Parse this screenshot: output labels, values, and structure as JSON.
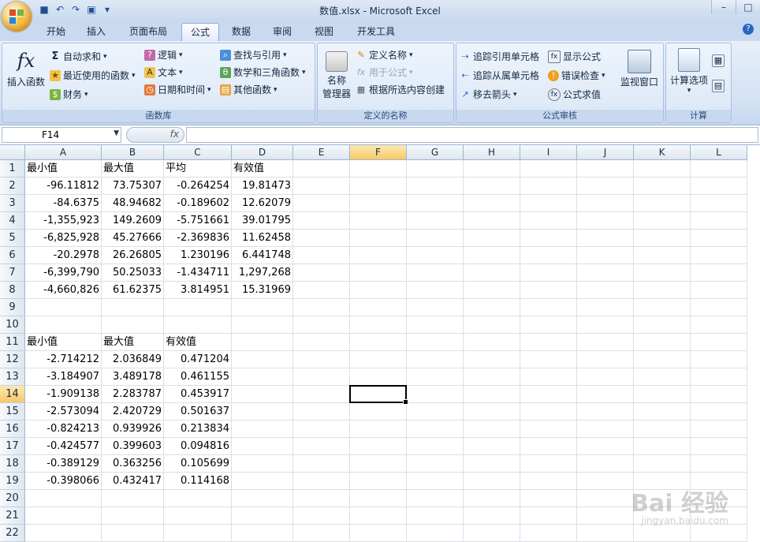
{
  "window": {
    "title": "数值.xlsx - Microsoft Excel",
    "minimize": "–",
    "restore": "□"
  },
  "tabs": [
    "开始",
    "插入",
    "页面布局",
    "公式",
    "数据",
    "审阅",
    "视图",
    "开发工具"
  ],
  "active_tab": "公式",
  "ribbon": {
    "function_library": {
      "label": "函数库",
      "insert_function": "插入函数",
      "autosum": "自动求和",
      "recent": "最近使用的函数",
      "financial": "财务",
      "logical": "逻辑",
      "text": "文本",
      "datetime": "日期和时间",
      "lookup": "查找与引用",
      "math": "数学和三角函数",
      "more": "其他函数"
    },
    "defined_names": {
      "label": "定义的名称",
      "name_manager_line1": "名称",
      "name_manager_line2": "管理器",
      "define_name": "定义名称",
      "use_in_formula": "用于公式",
      "create_from_selection": "根据所选内容创建"
    },
    "formula_auditing": {
      "label": "公式审核",
      "trace_precedents": "追踪引用单元格",
      "trace_dependents": "追踪从属单元格",
      "remove_arrows": "移去箭头",
      "show_formulas": "显示公式",
      "error_checking": "错误检查",
      "evaluate_formula": "公式求值",
      "watch_window": "监视窗口"
    },
    "calculation": {
      "label": "计算",
      "options": "计算选项"
    }
  },
  "formula_bar": {
    "name_box": "F14",
    "fx": "fx",
    "formula": ""
  },
  "sheet": {
    "columns": [
      "A",
      "B",
      "C",
      "D",
      "E",
      "F",
      "G",
      "H",
      "I",
      "J",
      "K",
      "L"
    ],
    "selected_column": "F",
    "rows": [
      "1",
      "2",
      "3",
      "4",
      "5",
      "6",
      "7",
      "8",
      "9",
      "10",
      "11",
      "12",
      "13",
      "14",
      "15",
      "16",
      "17",
      "18",
      "19",
      "20",
      "21",
      "22"
    ],
    "selected_row": "14",
    "active_cell": "F14",
    "cells": {
      "A1": "最小值",
      "B1": "最大值",
      "C1": "平均",
      "D1": "有效值",
      "A2": "-96.11812",
      "B2": "73.75307",
      "C2": "-0.264254",
      "D2": "19.81473",
      "A3": "-84.6375",
      "B3": "48.94682",
      "C3": "-0.189602",
      "D3": "12.62079",
      "A4": "-1,355,923",
      "B4": "149.2609",
      "C4": "-5.751661",
      "D4": "39.01795",
      "A5": "-6,825,928",
      "B5": "45.27666",
      "C5": "-2.369836",
      "D5": "11.62458",
      "A6": "-20.2978",
      "B6": "26.26805",
      "C6": "1.230196",
      "D6": "6.441748",
      "A7": "-6,399,790",
      "B7": "50.25033",
      "C7": "-1.434711",
      "D7": "1,297,268",
      "A8": "-4,660,826",
      "B8": "61.62375",
      "C8": "3.814951",
      "D8": "15.31969",
      "A11": "最小值",
      "B11": "最大值",
      "C11": "有效值",
      "A12": "-2.714212",
      "B12": "2.036849",
      "C12": "0.471204",
      "A13": "-3.184907",
      "B13": "3.489178",
      "C13": "0.461155",
      "A14": "-1.909138",
      "B14": "2.283787",
      "C14": "0.453917",
      "A15": "-2.573094",
      "B15": "2.420729",
      "C15": "0.501637",
      "A16": "-0.824213",
      "B16": "0.939926",
      "C16": "0.213834",
      "A17": "-0.424577",
      "B17": "0.399603",
      "C17": "0.094816",
      "A18": "-0.389129",
      "B18": "0.363256",
      "C18": "0.105699",
      "A19": "-0.398066",
      "B19": "0.432417",
      "C19": "0.114168"
    }
  },
  "watermark": {
    "text": "Bai 经验",
    "url": "jingyan.baidu.com"
  }
}
